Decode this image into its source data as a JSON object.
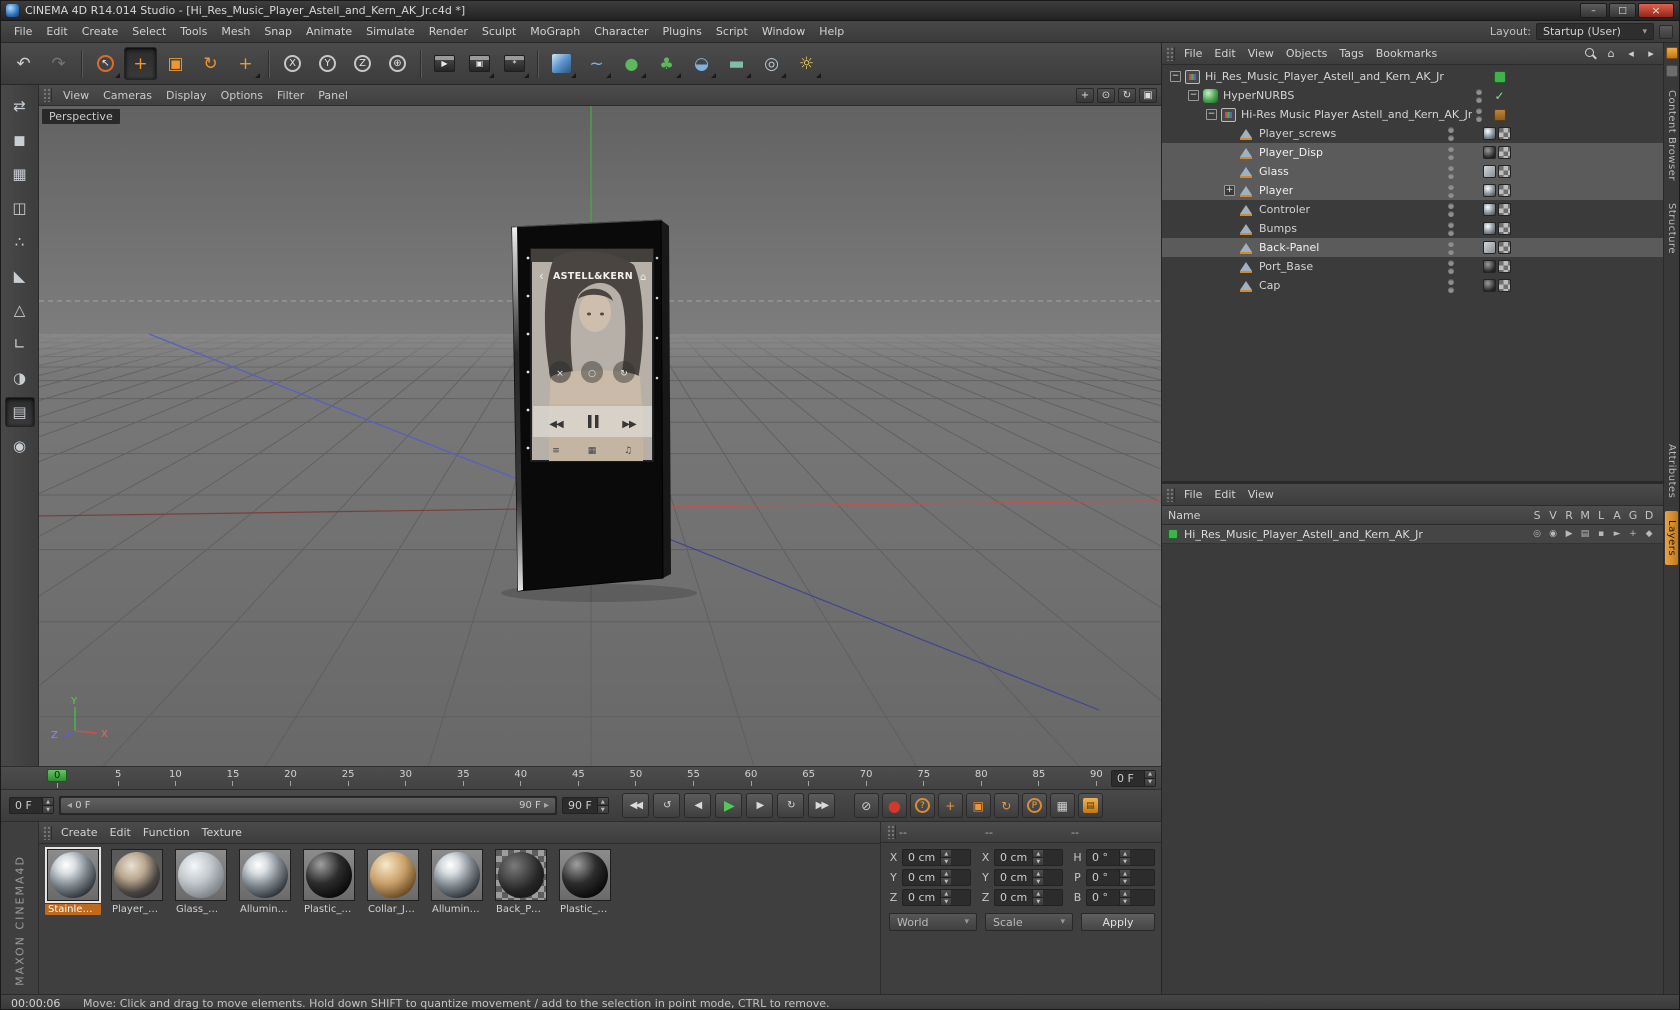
{
  "window": {
    "title": "CINEMA 4D R14.014 Studio - [Hi_Res_Music_Player_Astell_and_Kern_AK_Jr.c4d *]"
  },
  "menubar": {
    "items": [
      "File",
      "Edit",
      "Create",
      "Select",
      "Tools",
      "Mesh",
      "Snap",
      "Animate",
      "Simulate",
      "Render",
      "Sculpt",
      "MoGraph",
      "Character",
      "Plugins",
      "Script",
      "Window",
      "Help"
    ],
    "layout_label": "Layout:",
    "layout_value": "Startup (User)"
  },
  "toolbar": {
    "buttons": [
      {
        "name": "undo-icon",
        "glyph": "↶"
      },
      {
        "name": "redo-icon",
        "glyph": "↷",
        "disabled": true
      },
      {
        "name": "toolbar-separator",
        "style": "sep"
      },
      {
        "name": "live-selection-icon",
        "glyph": "↖",
        "tone": "livesel",
        "more": true
      },
      {
        "name": "move-icon",
        "glyph": "+",
        "tone": "orange",
        "active": true
      },
      {
        "name": "scale-icon",
        "glyph": "▣",
        "tone": "orange"
      },
      {
        "name": "rotate-icon",
        "glyph": "↻",
        "tone": "orange"
      },
      {
        "name": "last-tool-icon",
        "glyph": "+",
        "tone": "orange",
        "more": true
      },
      {
        "name": "toolbar-separator",
        "style": "sep"
      },
      {
        "name": "lock-x-icon",
        "glyph": "X",
        "tone": "circle"
      },
      {
        "name": "lock-y-icon",
        "glyph": "Y",
        "tone": "circle"
      },
      {
        "name": "lock-z-icon",
        "glyph": "Z",
        "tone": "circle"
      },
      {
        "name": "coordinate-system-icon",
        "glyph": "⊕",
        "tone": "circle"
      },
      {
        "name": "toolbar-separator",
        "style": "sep"
      },
      {
        "name": "render-view-icon",
        "glyph": "▶",
        "tone": "clapper"
      },
      {
        "name": "render-picture-viewer-icon",
        "glyph": "▣",
        "tone": "clapper",
        "more": true
      },
      {
        "name": "render-settings-icon",
        "glyph": "*",
        "tone": "clapper",
        "more": true
      },
      {
        "name": "toolbar-separator",
        "style": "sep"
      },
      {
        "name": "add-cube-icon",
        "glyph": "",
        "tone": "cube",
        "more": true
      },
      {
        "name": "add-spline-icon",
        "glyph": "~",
        "tone": "blue",
        "more": true
      },
      {
        "name": "add-hypernurbs-icon",
        "glyph": "●",
        "tone": "green",
        "more": true
      },
      {
        "name": "add-array-icon",
        "glyph": "♣",
        "tone": "green",
        "more": true
      },
      {
        "name": "add-deformer-icon",
        "glyph": "◒",
        "tone": "blue",
        "more": true
      },
      {
        "name": "add-environment-icon",
        "glyph": "▬",
        "tone": "teal",
        "more": true
      },
      {
        "name": "add-camera-icon",
        "glyph": "◎",
        "tone": "slate",
        "more": true
      },
      {
        "name": "add-light-icon",
        "glyph": "☼",
        "tone": "yellow",
        "more": true
      }
    ]
  },
  "left_toolbar": {
    "buttons": [
      {
        "name": "make-editable-icon",
        "glyph": "⇄",
        "tone": "dim"
      },
      {
        "name": "model-mode-icon",
        "glyph": "◼",
        "tone": "slate"
      },
      {
        "name": "texture-mode-icon",
        "glyph": "▦",
        "tone": "slate"
      },
      {
        "name": "workplane-mode-icon",
        "glyph": "◫",
        "tone": "slate"
      },
      {
        "name": "points-mode-icon",
        "glyph": "∴",
        "tone": "slate"
      },
      {
        "name": "edges-mode-icon",
        "glyph": "◣",
        "tone": "slate"
      },
      {
        "name": "polygons-mode-icon",
        "glyph": "△",
        "tone": "slate"
      },
      {
        "name": "axis-mode-icon",
        "glyph": "∟",
        "tone": "orange"
      },
      {
        "name": "texture-axis-mode-icon",
        "glyph": "◑",
        "tone": "orange"
      },
      {
        "name": "workplane-lock-icon",
        "glyph": "▤",
        "tone": "slate",
        "active": true
      },
      {
        "name": "snap-settings-icon",
        "glyph": "◉",
        "tone": "orange"
      }
    ]
  },
  "viewport": {
    "menu": [
      "View",
      "Cameras",
      "Display",
      "Options",
      "Filter",
      "Panel"
    ],
    "view_icons": [
      {
        "name": "pan-view-icon",
        "glyph": "+"
      },
      {
        "name": "zoom-view-icon",
        "glyph": "⊙"
      },
      {
        "name": "rotate-view-icon",
        "glyph": "↻"
      },
      {
        "name": "toggle-views-icon",
        "glyph": "▣"
      }
    ],
    "camera_label": "Perspective",
    "axis": {
      "x": "X",
      "y": "Y",
      "z": "Z"
    },
    "player": {
      "brand": "ASTELL&KERN"
    }
  },
  "object_manager": {
    "menu": [
      "File",
      "Edit",
      "View",
      "Objects",
      "Tags",
      "Bookmarks"
    ],
    "icons": {
      "home": "⌂",
      "back": "◂",
      "forward": "▸"
    },
    "tree": [
      {
        "label": "Hi_Res_Music_Player_Astell_and_Kern_AK_Jr",
        "depth": 0,
        "expander": "minus",
        "icon": "nullobj",
        "extra": "layer"
      },
      {
        "label": "HyperNURBS",
        "depth": 1,
        "expander": "minus",
        "icon": "hnurbs",
        "dots": true,
        "extra": "check"
      },
      {
        "label": "Hi-Res Music Player Astell_and_Kern_AK_Jr",
        "depth": 2,
        "expander": "minus",
        "icon": "nullobj",
        "dots": true,
        "extra": "grid"
      },
      {
        "label": "Player_screws",
        "depth": 3,
        "icon": "mesh",
        "dots": true,
        "tags": [
          "chrome",
          "checker"
        ]
      },
      {
        "label": "Player_Disp",
        "depth": 3,
        "icon": "mesh",
        "dots": true,
        "tags": [
          "dark",
          "checker"
        ],
        "selected": true
      },
      {
        "label": "Glass",
        "depth": 3,
        "icon": "mesh",
        "dots": true,
        "tags": [
          "glass",
          "checker"
        ],
        "selected": true
      },
      {
        "label": "Player",
        "depth": 3,
        "expander": "plus",
        "icon": "mesh",
        "dots": true,
        "tags": [
          "chrome",
          "checker"
        ],
        "selected": true
      },
      {
        "label": "Controler",
        "depth": 3,
        "icon": "mesh",
        "dots": true,
        "tags": [
          "chrome",
          "checker"
        ]
      },
      {
        "label": "Bumps",
        "depth": 3,
        "icon": "mesh",
        "dots": true,
        "tags": [
          "chrome",
          "checker"
        ]
      },
      {
        "label": "Back-Panel",
        "depth": 3,
        "icon": "mesh",
        "dots": true,
        "tags": [
          "glass",
          "checker"
        ],
        "selected": true
      },
      {
        "label": "Port_Base",
        "depth": 3,
        "icon": "mesh",
        "dots": true,
        "tags": [
          "dark",
          "checker"
        ]
      },
      {
        "label": "Cap",
        "depth": 3,
        "icon": "mesh",
        "dots": true,
        "tags": [
          "dark",
          "checker"
        ]
      }
    ]
  },
  "layer_manager": {
    "menu": [
      "File",
      "Edit",
      "View"
    ],
    "name_header": "Name",
    "columns": [
      "S",
      "V",
      "R",
      "M",
      "L",
      "A",
      "G",
      "D"
    ],
    "rows": [
      {
        "label": "Hi_Res_Music_Player_Astell_and_Kern_AK_Jr"
      }
    ],
    "toggle_icons": [
      "◎",
      "◉",
      "▶",
      "▤",
      "▪",
      "►",
      "+",
      "◆"
    ]
  },
  "side_tabs": {
    "upper": [
      {
        "label": "Content Browser"
      },
      {
        "label": "Structure"
      }
    ],
    "lower": [
      {
        "label": "Attributes"
      },
      {
        "label": "Layers",
        "active": true
      }
    ]
  },
  "timeline": {
    "ticks": [
      "0",
      "5",
      "10",
      "15",
      "20",
      "25",
      "30",
      "35",
      "40",
      "45",
      "50",
      "55",
      "60",
      "65",
      "70",
      "75",
      "80",
      "85",
      "90"
    ],
    "frame_value": "0 F"
  },
  "transport": {
    "start_value": "0 F",
    "slider_start": "0 F",
    "slider_end": "90 F",
    "end_value": "90 F",
    "buttons": [
      {
        "name": "goto-start-button",
        "glyph": "◀◀"
      },
      {
        "name": "prev-key-button",
        "glyph": "↺"
      },
      {
        "name": "prev-frame-button",
        "glyph": "◀"
      },
      {
        "name": "play-button",
        "glyph": "▶",
        "tone": "play"
      },
      {
        "name": "next-frame-button",
        "glyph": "▶"
      },
      {
        "name": "next-key-button",
        "glyph": "↻"
      },
      {
        "name": "goto-end-button",
        "glyph": "▶▶"
      }
    ],
    "key_buttons": [
      {
        "name": "record-keyframe-icon",
        "glyph": "⊘",
        "tone": "dim"
      },
      {
        "name": "autokeying-icon",
        "glyph": "●",
        "tone": "red"
      },
      {
        "name": "keying-help-icon",
        "glyph": "?",
        "tone": "orangecircle"
      },
      {
        "name": "key-position-icon",
        "glyph": "+",
        "tone": "orange"
      },
      {
        "name": "key-scale-icon",
        "glyph": "▣",
        "tone": "orange"
      },
      {
        "name": "key-rotation-icon",
        "glyph": "↻",
        "tone": "orange"
      },
      {
        "name": "key-parameter-icon",
        "glyph": "P",
        "tone": "orangecircle"
      },
      {
        "name": "key-pla-icon",
        "glyph": "▦",
        "tone": "dim"
      },
      {
        "name": "keying-settings-icon",
        "glyph": "▤",
        "tone": "amber"
      }
    ]
  },
  "materials": {
    "menu": [
      "Create",
      "Edit",
      "Function",
      "Texture"
    ],
    "items": [
      {
        "label": "Stainlees_S",
        "style": "chrome",
        "selected": true
      },
      {
        "label": "Player_Disp",
        "style": "display"
      },
      {
        "label": "Glass_Mair",
        "style": "glass"
      },
      {
        "label": "Alluminium",
        "style": "chrome"
      },
      {
        "label": "Plastic_Blac",
        "style": "black"
      },
      {
        "label": "Collar_Jack",
        "style": "bronze"
      },
      {
        "label": "Alluminium",
        "style": "chrome"
      },
      {
        "label": "Back_Panel",
        "style": "panel"
      },
      {
        "label": "Plastic_Blac",
        "style": "black"
      }
    ],
    "brand": "MAXON CINEMA4D"
  },
  "coordinates": {
    "header_dashes": [
      "--",
      "--",
      "--"
    ],
    "cells": [
      {
        "l": "X",
        "v": "0 cm"
      },
      {
        "l": "X",
        "v": "0 cm"
      },
      {
        "l": "H",
        "v": "0 °"
      },
      {
        "l": "Y",
        "v": "0 cm"
      },
      {
        "l": "Y",
        "v": "0 cm"
      },
      {
        "l": "P",
        "v": "0 °"
      },
      {
        "l": "Z",
        "v": "0 cm"
      },
      {
        "l": "Z",
        "v": "0 cm"
      },
      {
        "l": "B",
        "v": "0 °"
      }
    ],
    "world_label": "World",
    "scale_label": "Scale",
    "apply_label": "Apply"
  },
  "statusbar": {
    "time": "00:00:06",
    "message": "Move: Click and drag to move elements. Hold down SHIFT to quantize movement / add to the selection in point mode, CTRL to remove."
  }
}
